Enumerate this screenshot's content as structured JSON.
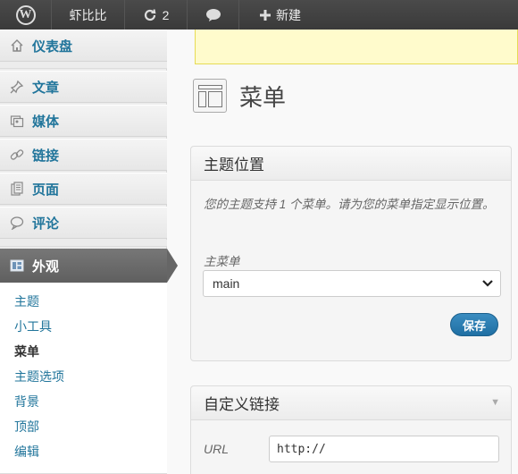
{
  "adminbar": {
    "logo_letter": "W",
    "site_name": "虾比比",
    "updates_count": "2",
    "new_label": "新建"
  },
  "sidebar": {
    "dashboard": "仪表盘",
    "posts": "文章",
    "media": "媒体",
    "links": "链接",
    "pages": "页面",
    "comments": "评论",
    "appearance": "外观",
    "submenu": [
      "主题",
      "小工具",
      "菜单",
      "主题选项",
      "背景",
      "顶部",
      "编辑"
    ],
    "current_submenu": "菜单"
  },
  "page": {
    "title": "菜单"
  },
  "theme_locations": {
    "title": "主题位置",
    "description": "您的主题支持 1 个菜单。请为您的菜单指定显示位置。",
    "field_label": "主菜单",
    "selected": "main",
    "save_label": "保存"
  },
  "custom_links": {
    "title": "自定义链接",
    "url_label": "URL",
    "url_value": "http://"
  },
  "icons": {
    "wp_logo": "wordpress-logo-icon",
    "updates": "refresh-icon",
    "comments": "comment-bubble-icon",
    "new": "plus-icon",
    "dashboard": "home-icon",
    "posts": "pin-icon",
    "media": "media-icon",
    "links": "link-icon",
    "pages": "page-icon",
    "comments_menu": "comment-icon",
    "appearance": "appearance-icon"
  },
  "colors": {
    "link": "#21759b",
    "adminbar": "#464646",
    "active_menu": "#6d6d6d",
    "save_button": "#2a7db5",
    "notice": "#fffbcc"
  }
}
